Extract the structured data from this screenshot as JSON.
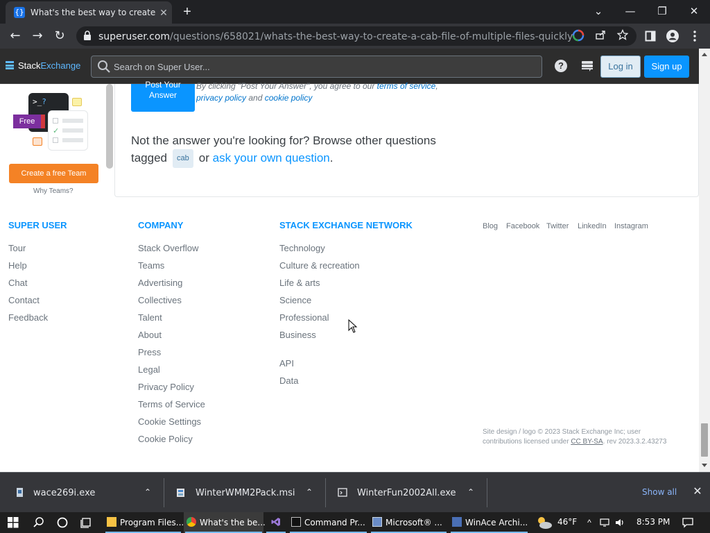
{
  "browser": {
    "tab_title": "What's the best way to create a .c",
    "tab_favicon_glyph": "{}",
    "tab_close_glyph": "✕",
    "new_tab_glyph": "+",
    "window_controls": {
      "tablist": "⌄",
      "minimize": "—",
      "restore": "❐",
      "close": "✕"
    },
    "nav": {
      "back": "←",
      "forward": "→",
      "reload": "↻"
    },
    "url_host": "superuser.com",
    "url_path": "/questions/658021/whats-the-best-way-to-create-a-cab-file-of-multiple-files-quickly",
    "omnibox_icons": [
      "google-lens-icon",
      "share-icon",
      "star-icon"
    ],
    "toolbar_icons": [
      "sidebar-icon",
      "profile-icon",
      "menu-icon"
    ]
  },
  "se_header": {
    "logo_stack": "Stack",
    "logo_exchange": "Exchange",
    "search_placeholder": "Search on Super User...",
    "login_label": "Log in",
    "signup_label": "Sign up"
  },
  "sidebar": {
    "promo_prompt": ">_",
    "promo_q": "?",
    "free_badge": "Free",
    "create_team_label": "Create a free Team",
    "why_teams_label": "Why Teams?"
  },
  "main": {
    "post_button_label": "Post Your Answer",
    "agree_prefix": "By clicking \"Post Your Answer\", you agree to our ",
    "terms_link": "terms of service",
    "agree_comma": ",",
    "privacy_link": "privacy policy",
    "agree_and": " and ",
    "cookie_link": "cookie policy",
    "not_answer_text": "Not the answer you're looking for? Browse other questions tagged",
    "tag": "cab",
    "or_text": "or",
    "ask_link": "ask your own question",
    "period": "."
  },
  "footer": {
    "super_user": {
      "heading": "SUPER USER",
      "links": [
        "Tour",
        "Help",
        "Chat",
        "Contact",
        "Feedback"
      ]
    },
    "company": {
      "heading": "COMPANY",
      "links": [
        "Stack Overflow",
        "Teams",
        "Advertising",
        "Collectives",
        "Talent",
        "About",
        "Press",
        "Legal",
        "Privacy Policy",
        "Terms of Service",
        "Cookie Settings",
        "Cookie Policy"
      ]
    },
    "network": {
      "heading": "STACK EXCHANGE NETWORK",
      "links": [
        "Technology",
        "Culture & recreation",
        "Life & arts",
        "Science",
        "Professional",
        "Business"
      ],
      "links2": [
        "API",
        "Data"
      ]
    },
    "social": [
      "Blog",
      "Facebook",
      "Twitter",
      "LinkedIn",
      "Instagram"
    ],
    "copyright_line1": "Site design / logo © 2023 Stack Exchange Inc; user",
    "copyright_line2_prefix": "contributions licensed under ",
    "license": "CC BY-SA",
    "copyright_line2_suffix": ". rev 2023.3.2.43273"
  },
  "downloads": {
    "items": [
      {
        "name": "wace269i.exe",
        "icon": "exe-icon"
      },
      {
        "name": "WinterWMM2Pack.msi",
        "icon": "msi-icon"
      },
      {
        "name": "WinterFun2002All.exe",
        "icon": "exe-icon"
      }
    ],
    "chevron_glyph": "⌃",
    "show_all_label": "Show all",
    "close_glyph": "✕"
  },
  "taskbar": {
    "apps": [
      {
        "label": "Program Files...",
        "icon": "folder-icon"
      },
      {
        "label": "What's the be...",
        "icon": "chrome-icon"
      },
      {
        "label": "",
        "icon": "visual-studio-icon"
      },
      {
        "label": "Command Pr...",
        "icon": "cmd-icon"
      },
      {
        "label": "Microsoft® ...",
        "icon": "installer-icon"
      },
      {
        "label": "WinAce Archi...",
        "icon": "winace-icon"
      }
    ],
    "temperature": "46°F",
    "time": "8:53 PM"
  },
  "colors": {
    "accent": "#0a95ff",
    "orange": "#f48225",
    "chrome_dark": "#202124",
    "chrome_toolbar": "#35363a"
  }
}
